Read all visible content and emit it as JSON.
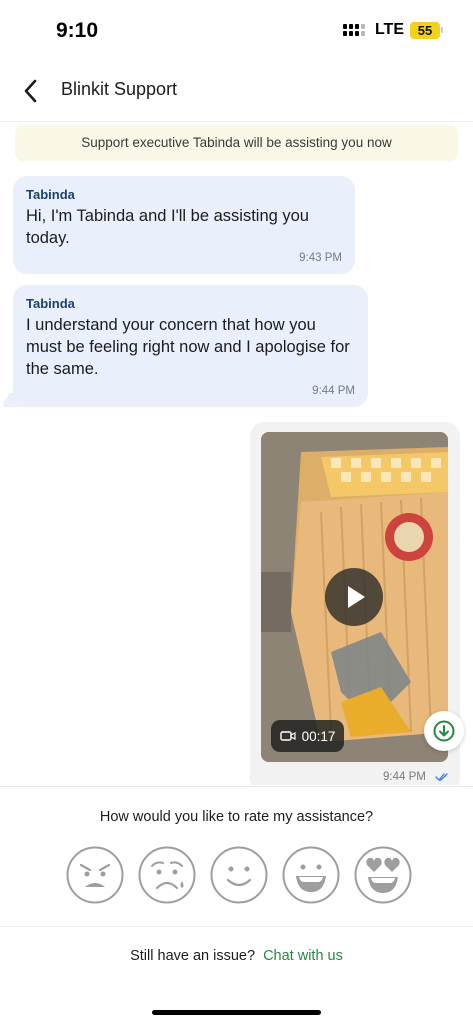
{
  "status_bar": {
    "time": "9:10",
    "network": "LTE",
    "battery": "55"
  },
  "header": {
    "title": "Blinkit Support"
  },
  "notice": "Support executive Tabinda will be assisting you now",
  "messages": [
    {
      "sender": "Tabinda",
      "text": "Hi, I'm Tabinda and I'll be assisting you today.",
      "time": "9:43 PM"
    },
    {
      "sender": "Tabinda",
      "text": "I understand your concern that how you must be feeling right now and I apologise for the same.",
      "time": "9:44 PM"
    }
  ],
  "media_message": {
    "duration": "00:17",
    "time": "9:44 PM",
    "status": "read"
  },
  "rating": {
    "question": "How would you like to rate my assistance?",
    "options": [
      "angry-face-icon",
      "crying-face-icon",
      "smiling-face-icon",
      "grinning-face-icon",
      "heart-eyes-face-icon"
    ]
  },
  "footer": {
    "text": "Still have an issue?",
    "link": "Chat with us"
  },
  "colors": {
    "bubble": "#e9f0fb",
    "notice_bg": "#fbf7e6",
    "link": "#25883f",
    "sender": "#1d3f6c",
    "battery": "#f4d21c"
  }
}
